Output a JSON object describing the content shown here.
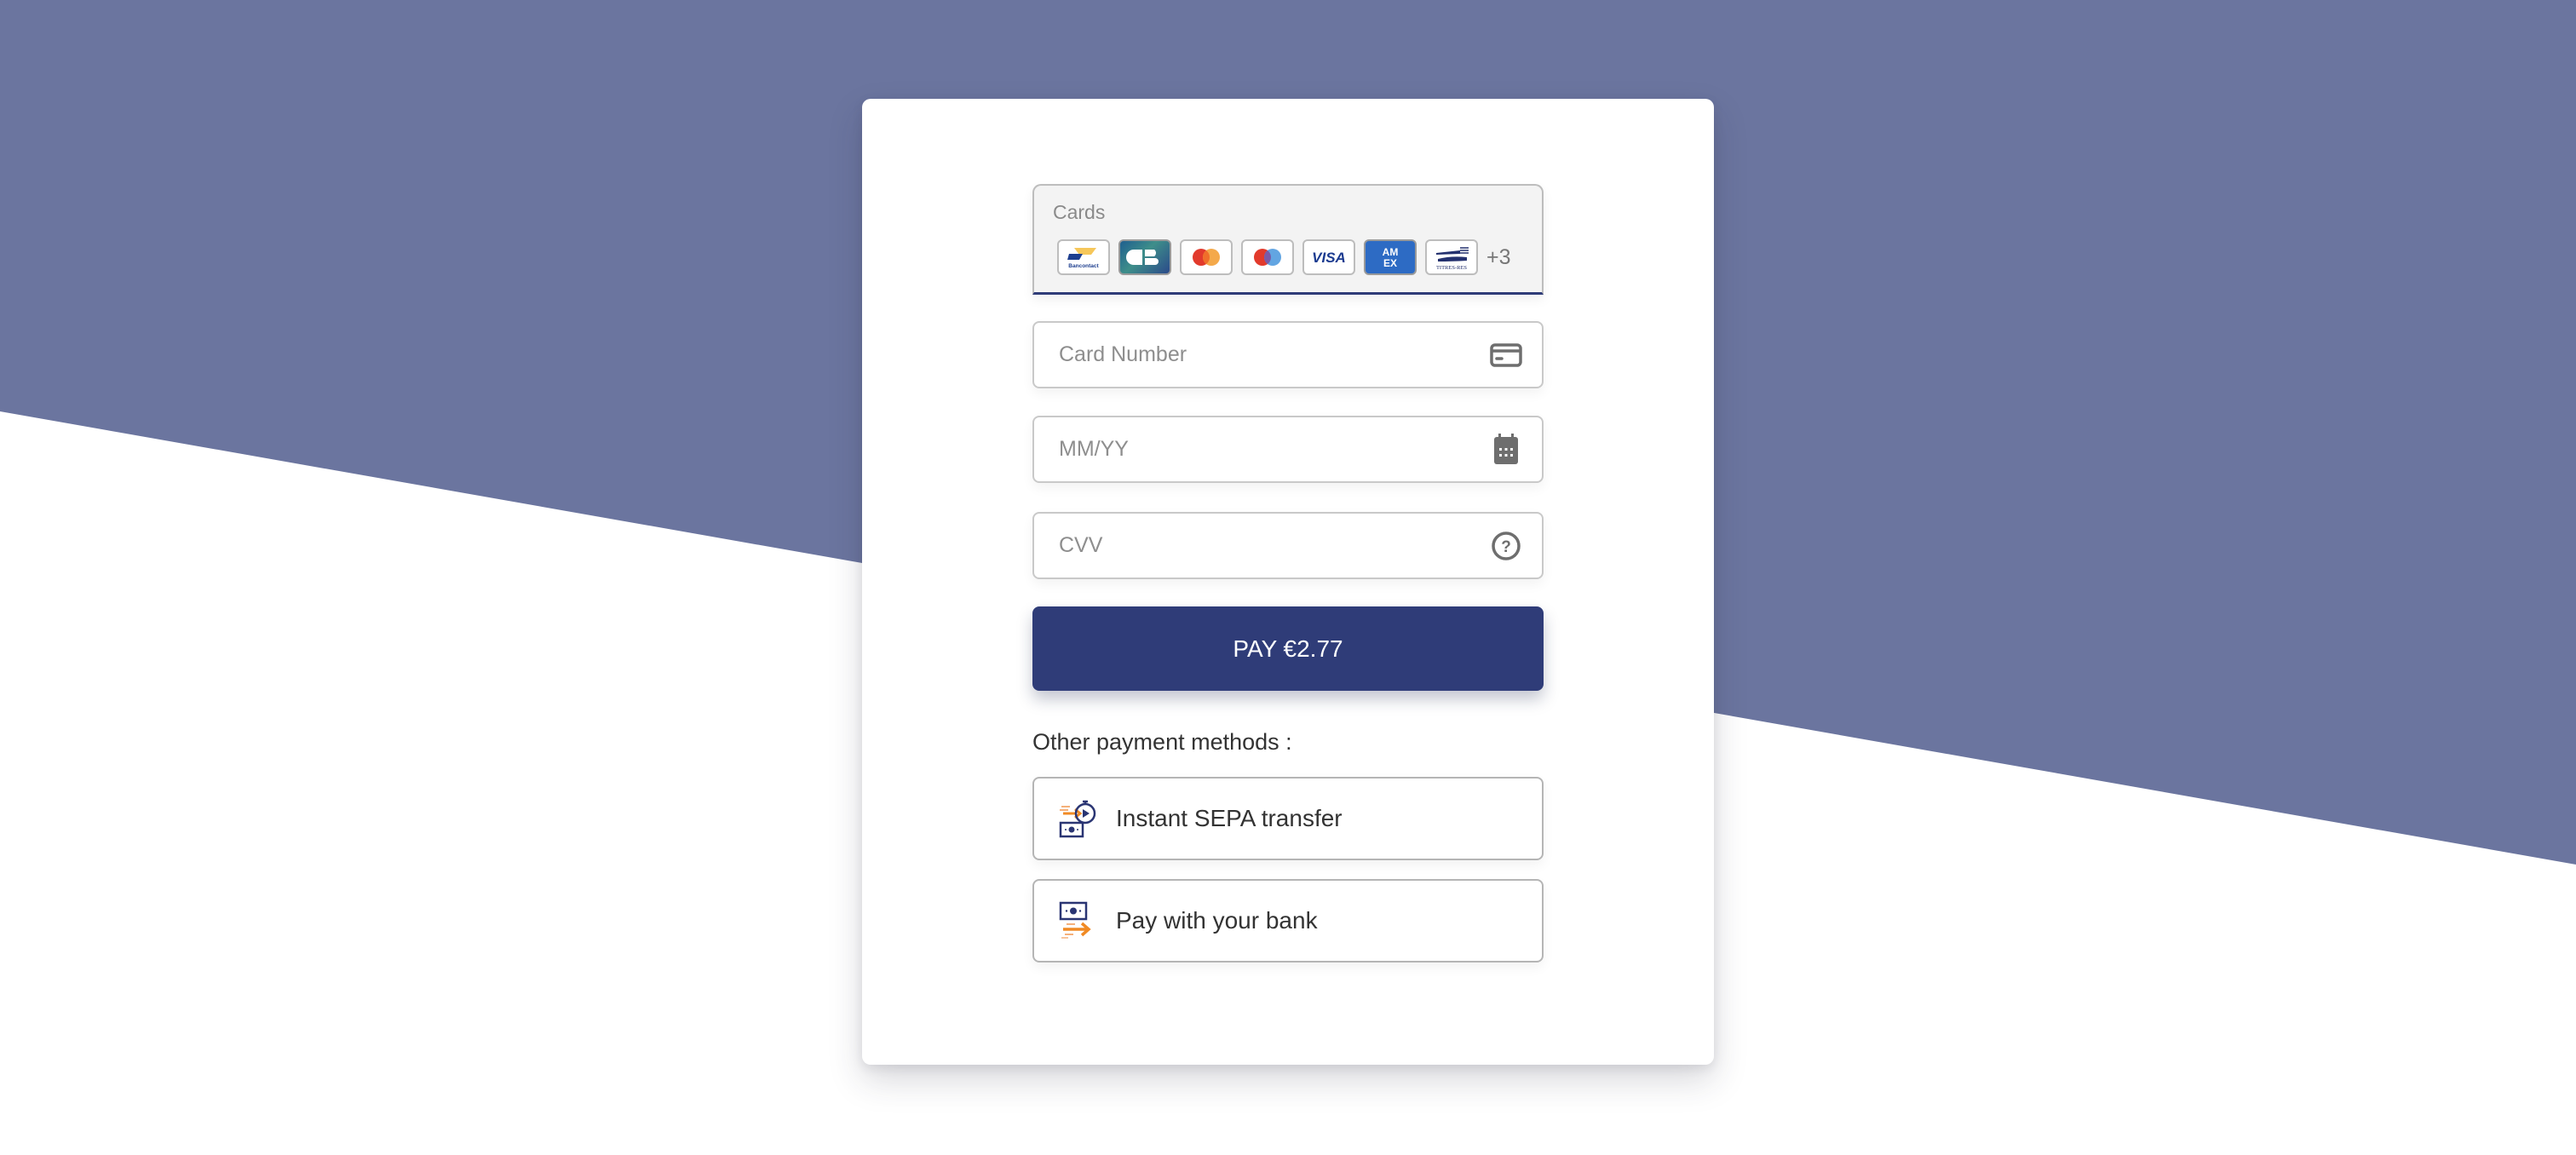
{
  "theme": {
    "background_top": "#6b759f",
    "background_bottom": "#ffffff",
    "primary": "#2f3c78",
    "accent_orange": "#f08a24"
  },
  "cards": {
    "label": "Cards",
    "brands": [
      {
        "name": "Bancontact",
        "text": "Bancontact"
      },
      {
        "name": "CB",
        "text": "CB"
      },
      {
        "name": "Mastercard",
        "text": ""
      },
      {
        "name": "Maestro",
        "text": ""
      },
      {
        "name": "Visa",
        "text": "VISA"
      },
      {
        "name": "American Express",
        "text": "AMEX"
      },
      {
        "name": "Titres-Restaurant",
        "text": "TITRES-RES"
      }
    ],
    "more_count": "+3"
  },
  "form": {
    "card_number": {
      "placeholder": "Card Number",
      "value": "",
      "icon": "credit-card-icon"
    },
    "expiry": {
      "placeholder": "MM/YY",
      "value": "",
      "icon": "calendar-icon"
    },
    "cvv": {
      "placeholder": "CVV",
      "value": "",
      "icon": "help-circle-icon"
    }
  },
  "pay_button": {
    "label": "PAY €2.77"
  },
  "other_methods": {
    "label": "Other payment methods :",
    "items": [
      {
        "label": "Instant SEPA transfer",
        "icon": "instant-transfer-icon"
      },
      {
        "label": "Pay with your bank",
        "icon": "bank-transfer-icon"
      }
    ]
  }
}
